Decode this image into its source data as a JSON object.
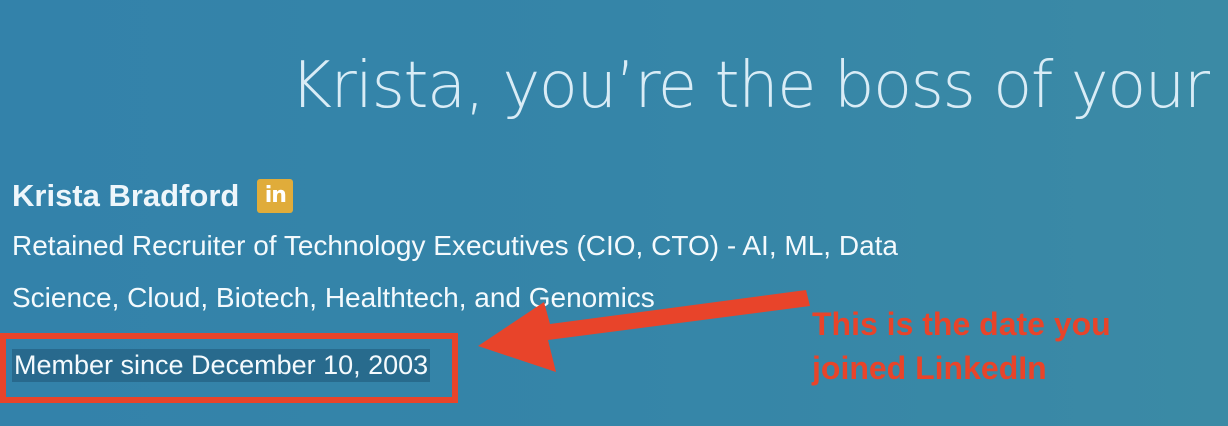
{
  "headline": "Krista, you’re the boss of your a",
  "profile": {
    "name": "Krista Bradford",
    "badge_text": "in",
    "tagline_line1": "Retained Recruiter of Technology Executives (CIO, CTO) - AI, ML, Data",
    "tagline_line2": "Science, Cloud, Biotech, Healthtech, and Genomics",
    "member_since": "Member since December 10, 2003"
  },
  "annotation": {
    "line1": "This is the date you",
    "line2": "joined LinkedIn"
  },
  "colors": {
    "background": "#3585a8",
    "headline": "#d9ecf6",
    "linkedin_badge": "#e0ac3a",
    "annotation_red": "#e8442a"
  },
  "icons": {
    "linkedin": "linkedin-icon",
    "arrow": "arrow-left-icon"
  }
}
